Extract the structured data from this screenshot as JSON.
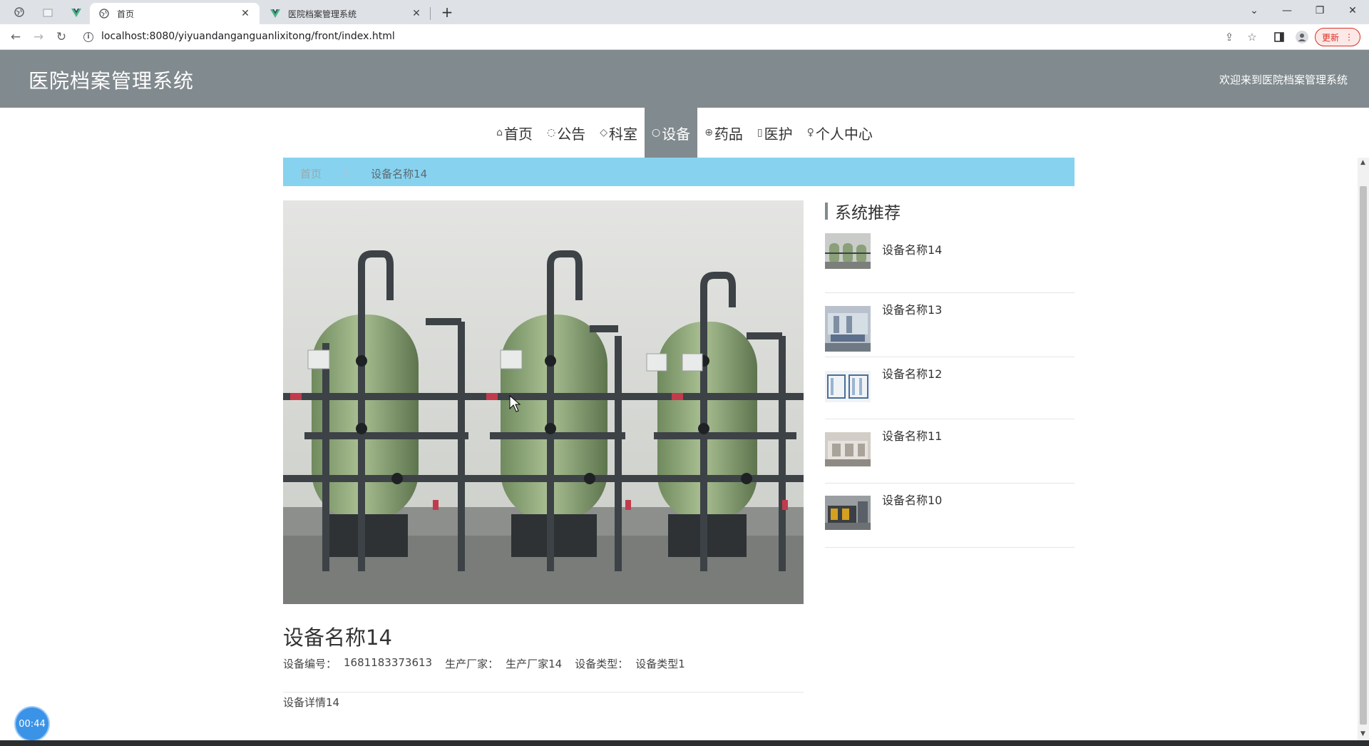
{
  "browser": {
    "tabs": [
      {
        "title": "首页",
        "active": true
      },
      {
        "title": "医院档案管理系统",
        "active": false
      }
    ],
    "url": "localhost:8080/yiyuandanganguanlixitong/front/index.html",
    "update_label": "更新"
  },
  "site": {
    "title": "医院档案管理系统",
    "welcome": "欢迎来到医院档案管理系统"
  },
  "nav": {
    "items": [
      {
        "label": "首页",
        "icon": "home-icon"
      },
      {
        "label": "公告",
        "icon": "megaphone-icon"
      },
      {
        "label": "科室",
        "icon": "tag-icon"
      },
      {
        "label": "设备",
        "icon": "circle-icon",
        "active": true
      },
      {
        "label": "药品",
        "icon": "globe-icon"
      },
      {
        "label": "医护",
        "icon": "clipboard-icon"
      },
      {
        "label": "个人中心",
        "icon": "user-icon"
      }
    ]
  },
  "breadcrumb": {
    "home": "首页",
    "separator": "/",
    "current": "设备名称14"
  },
  "detail": {
    "title": "设备名称14",
    "fields": [
      {
        "label": "设备编号：",
        "value": "1681183373613"
      },
      {
        "label": "生产厂家：",
        "value": "生产厂家14"
      },
      {
        "label": "设备类型：",
        "value": "设备类型1"
      }
    ],
    "description": "设备详情14"
  },
  "recommend": {
    "title": "系统推荐",
    "items": [
      {
        "name": "设备名称14"
      },
      {
        "name": "设备名称13"
      },
      {
        "name": "设备名称12"
      },
      {
        "name": "设备名称11"
      },
      {
        "name": "设备名称10"
      }
    ]
  },
  "timer": "00:44",
  "colors": {
    "header": "#818a8e",
    "breadcrumb": "#87d3ef",
    "nav_active": "#818a8e"
  }
}
